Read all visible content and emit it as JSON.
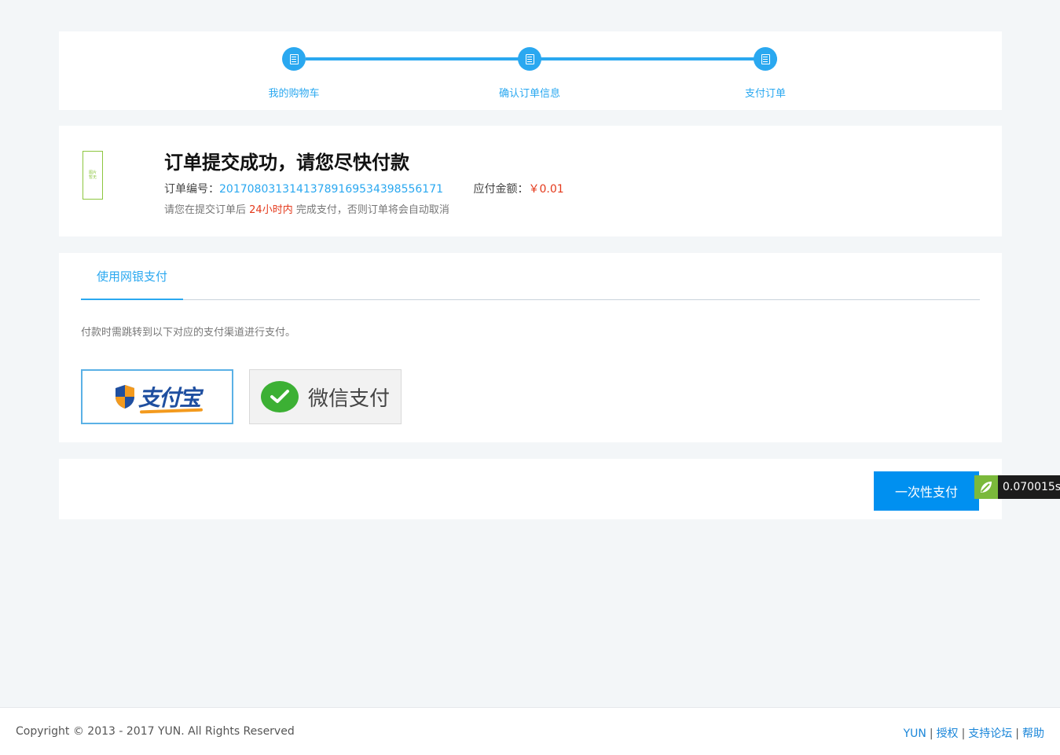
{
  "steps": {
    "items": [
      {
        "label": "我的购物车"
      },
      {
        "label": "确认订单信息"
      },
      {
        "label": "支付订单"
      }
    ],
    "accent_color": "#2aa8f0"
  },
  "order": {
    "image_text": "图片\n暂无",
    "title": "订单提交成功，请您尽快付款",
    "number_label": "订单编号：",
    "number": "20170803131413789169534398556171",
    "amount_label": "应付金额：",
    "amount": "￥0.01",
    "note_prefix": "请您在提交订单后",
    "note_highlight": "24小时内",
    "note_suffix": "完成支付，否则订单将会自动取消"
  },
  "payment": {
    "tab_label": "使用网银支付",
    "hint": "付款时需跳转到以下对应的支付渠道进行支付。",
    "options": [
      {
        "name": "alipay",
        "label": "支付宝",
        "icon": "alipay-logo"
      },
      {
        "name": "wechat",
        "label": "微信支付",
        "icon": "wechat-logo"
      }
    ]
  },
  "action": {
    "pay_button": "一次性支付"
  },
  "timer": {
    "value": "0.070015s"
  },
  "footer": {
    "copyright": "Copyright © 2013 - 2017 YUN. All Rights Reserved",
    "links": [
      "YUN",
      "授权",
      "支持论坛",
      "帮助"
    ],
    "separator": "|"
  }
}
